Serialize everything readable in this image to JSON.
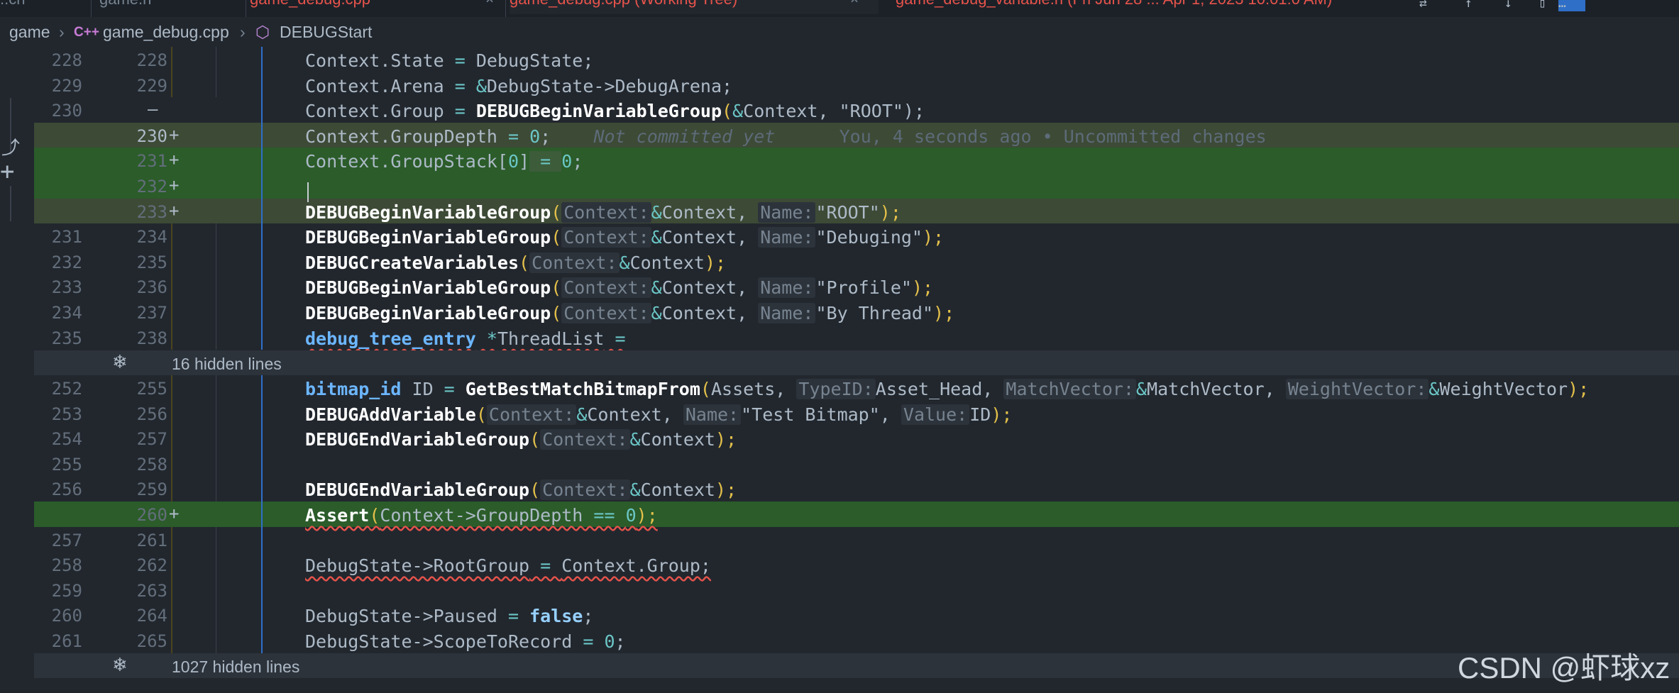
{
  "tabs": [
    {
      "label": "..ch",
      "state": "modified"
    },
    {
      "label": "game.h",
      "state": "normal"
    },
    {
      "label": "game_debug.cpp",
      "state": "modified"
    },
    {
      "label": "game_debug.cpp (Working Tree)",
      "state": "active"
    },
    {
      "label": "game_debug_variable.h (Fri Jun 28 ... Apr 1, 2023 10:01:0 AM)",
      "state": "modified"
    }
  ],
  "breadcrumb": {
    "folder": "game",
    "file": "game_debug.cpp",
    "symbol": "DEBUGStart",
    "file_icon": "c++-file-icon",
    "symbol_icon": "cube-symbol-icon"
  },
  "colors": {
    "deleted_line": "#6b2430",
    "added_line": "#2b5c2a",
    "background": "#22272e"
  },
  "lines": [
    {
      "old": "228",
      "new": "228",
      "mark": "",
      "kind": "ctx"
    },
    {
      "old": "229",
      "new": "229",
      "mark": "",
      "kind": "ctx"
    },
    {
      "old": "230",
      "new": "",
      "mark": "—",
      "kind": "del"
    },
    {
      "old": "",
      "new": "230",
      "mark": "+",
      "kind": "addhl"
    },
    {
      "old": "",
      "new": "231",
      "mark": "+",
      "kind": "add"
    },
    {
      "old": "",
      "new": "232",
      "mark": "+",
      "kind": "add"
    },
    {
      "old": "",
      "new": "233",
      "mark": "+",
      "kind": "addhl"
    },
    {
      "old": "231",
      "new": "234",
      "mark": "",
      "kind": "ctx"
    },
    {
      "old": "232",
      "new": "235",
      "mark": "",
      "kind": "ctx"
    },
    {
      "old": "233",
      "new": "236",
      "mark": "",
      "kind": "ctx"
    },
    {
      "old": "234",
      "new": "237",
      "mark": "",
      "kind": "ctx"
    },
    {
      "old": "235",
      "new": "238",
      "mark": "",
      "kind": "ctx"
    },
    {
      "old": "252",
      "new": "255",
      "mark": "",
      "kind": "ctx"
    },
    {
      "old": "253",
      "new": "256",
      "mark": "",
      "kind": "ctx"
    },
    {
      "old": "254",
      "new": "257",
      "mark": "",
      "kind": "ctx"
    },
    {
      "old": "255",
      "new": "258",
      "mark": "",
      "kind": "ctx"
    },
    {
      "old": "256",
      "new": "259",
      "mark": "",
      "kind": "ctx"
    },
    {
      "old": "",
      "new": "260",
      "mark": "+",
      "kind": "add"
    },
    {
      "old": "257",
      "new": "261",
      "mark": "",
      "kind": "ctx"
    },
    {
      "old": "258",
      "new": "262",
      "mark": "",
      "kind": "ctx"
    },
    {
      "old": "259",
      "new": "263",
      "mark": "",
      "kind": "ctx"
    },
    {
      "old": "260",
      "new": "264",
      "mark": "",
      "kind": "ctx"
    },
    {
      "old": "261",
      "new": "265",
      "mark": "",
      "kind": "ctx"
    }
  ],
  "code": {
    "l228": {
      "a": "Context.State",
      "b": " = ",
      "c": "DebugState;"
    },
    "l229": {
      "a": "Context.Arena",
      "b": " = ",
      "c": "&",
      "d": "DebugState->DebugArena;"
    },
    "l230del": {
      "a": "Context.Group",
      "b": " = ",
      "fn": "DEBUGBeginVariableGroup",
      "p1": "(",
      "amp": "&",
      "arg": "Context, ",
      "str": "\"ROOT\"",
      "p2": ");"
    },
    "l230": {
      "a": "Context.GroupDepth",
      "b": " = ",
      "num": "0",
      "c": ";",
      "blame": "Not committed yet",
      "blame2": "You, 4 seconds ago • Uncommitted changes"
    },
    "l231": {
      "a": "Context.GroupStack[",
      "num": "0",
      "c": "]",
      "b": " = ",
      "num2": "0",
      "d": ";"
    },
    "l233": {
      "fn": "DEBUGBeginVariableGroup",
      "p1": "(",
      "h1": "Context:",
      "amp": "&",
      "arg": "Context, ",
      "h2": "Name:",
      "str": "\"ROOT\"",
      "p2": ");"
    },
    "l234": {
      "fn": "DEBUGBeginVariableGroup",
      "p1": "(",
      "h1": "Context:",
      "amp": "&",
      "arg": "Context, ",
      "h2": "Name:",
      "str": "\"Debuging\"",
      "p2": ");"
    },
    "l235": {
      "fn": "DEBUGCreateVariables",
      "p1": "(",
      "h1": "Context:",
      "amp": "&",
      "arg": "Context",
      "p2": ");"
    },
    "l236": {
      "fn": "DEBUGBeginVariableGroup",
      "p1": "(",
      "h1": "Context:",
      "amp": "&",
      "arg": "Context, ",
      "h2": "Name:",
      "str": "\"Profile\"",
      "p2": ");"
    },
    "l237": {
      "fn": "DEBUGBeginVariableGroup",
      "p1": "(",
      "h1": "Context:",
      "amp": "&",
      "arg": "Context, ",
      "h2": "Name:",
      "str": "\"By Thread\"",
      "p2": ");"
    },
    "l238": {
      "kw": "debug_tree_entry",
      "op": " *",
      "a": "ThreadList",
      "b": " ="
    },
    "l255": {
      "kw": "bitmap_id",
      "a": " ID",
      "b": " = ",
      "fn": "GetBestMatchBitmapFrom",
      "p1": "(",
      "c": "Assets, ",
      "h1": "TypeID:",
      "d": "Asset_Head, ",
      "h2": "MatchVector:",
      "amp1": "&",
      "e": "MatchVector, ",
      "h3": "WeightVector:",
      "amp2": "&",
      "f": "WeightVector",
      "p2": ");"
    },
    "l256": {
      "fn": "DEBUGAddVariable",
      "p1": "(",
      "h1": "Context:",
      "amp": "&",
      "arg": "Context, ",
      "h2": "Name:",
      "str": "\"Test Bitmap\"",
      "c": ", ",
      "h3": "Value:",
      "d": "ID",
      "p2": ");"
    },
    "l257": {
      "fn": "DEBUGEndVariableGroup",
      "p1": "(",
      "h1": "Context:",
      "amp": "&",
      "arg": "Context",
      "p2": ");"
    },
    "l259": {
      "fn": "DEBUGEndVariableGroup",
      "p1": "(",
      "h1": "Context:",
      "amp": "&",
      "arg": "Context",
      "p2": ");"
    },
    "l260": {
      "fn": "Assert",
      "p1": "(",
      "a": "Context->GroupDepth",
      "op": " == ",
      "num": "0",
      "p2": ");"
    },
    "l262": {
      "a": "DebugState->RootGroup",
      "b": " = ",
      "c": "Context.Group;"
    },
    "l264": {
      "a": "DebugState->Paused",
      "b": " = ",
      "bool": "false",
      "c": ";"
    },
    "l265": {
      "a": "DebugState->ScopeToRecord",
      "b": " = ",
      "num": "0",
      "c": ";"
    }
  },
  "folds": [
    {
      "label": "16 hidden lines",
      "icon": "unfold-icon"
    },
    {
      "label": "1027 hidden lines",
      "icon": "unfold-icon"
    }
  ],
  "watermark": "CSDN @虾球xz"
}
